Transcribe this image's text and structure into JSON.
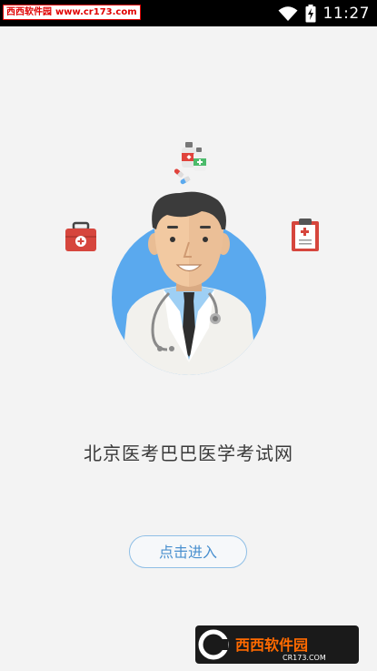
{
  "status_bar": {
    "time": "11:27",
    "watermark_name": "西西软件园",
    "watermark_url": "www.cr173.com",
    "icons": [
      "wifi-icon",
      "battery-charging-icon"
    ]
  },
  "main": {
    "title": "北京医考巴巴医学考试网",
    "enter_label": "点击进入"
  },
  "illustration": {
    "figure": "doctor-avatar",
    "icons": [
      "medicine-bottles-icon",
      "first-aid-kit-icon",
      "clipboard-icon"
    ]
  },
  "bottom_watermark": {
    "brand": "西西软件园",
    "url": "CR173.COM"
  },
  "colors": {
    "accent": "#4a90cf",
    "circle": "#5aa9ee",
    "background": "#f3f3f3"
  }
}
